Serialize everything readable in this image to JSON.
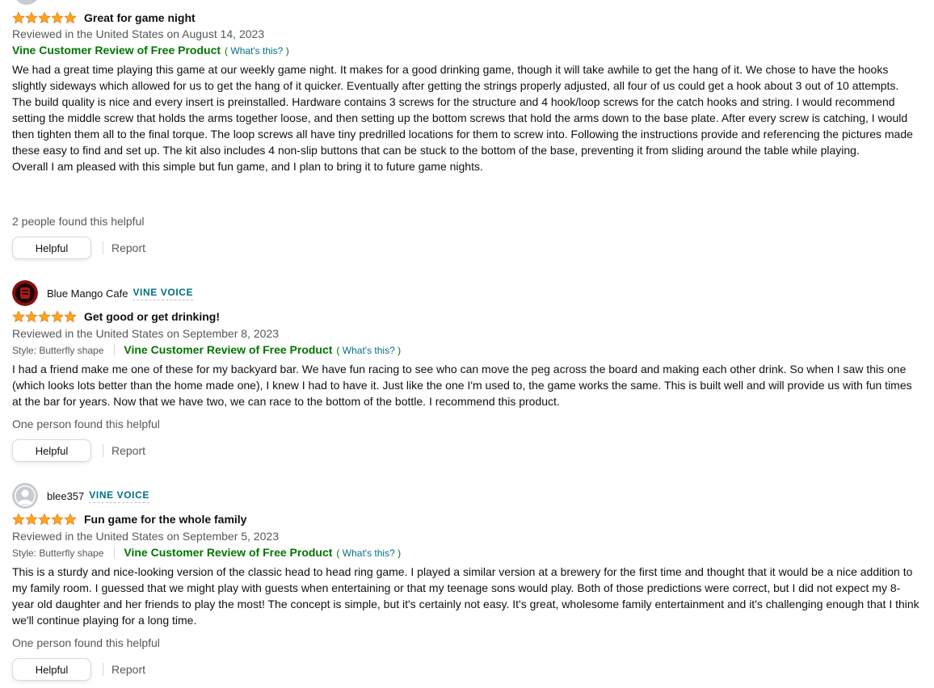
{
  "reviews": [
    {
      "rating": 5,
      "title": "Great for game night",
      "date_line": "Reviewed in the United States on August 14, 2023",
      "vine_label": "Vine Customer Review of Free Product",
      "whats_this": "What's this?",
      "body": [
        "We had a great time playing this game at our weekly game night. It makes for a good drinking game, though it will take awhile to get the hang of it. We chose to have the hooks slightly sideways which allowed for us to get the hang of it quicker. Eventually after getting the strings properly adjusted, all four of us could get a hook about 3 out of 10 attempts.",
        "The build quality is nice and every insert is preinstalled. Hardware contains 3 screws for the structure and 4 hook/loop screws for the catch hooks and string. I would recommend setting the middle screw that holds the arms together loose, and then setting up the bottom screws that hold the arms down to the base plate. After every screw is catching, I would then tighten them all to the final torque. The loop screws all have tiny predrilled locations for them to screw into. Following the instructions provide and referencing the pictures made these easy to find and set up. The kit also includes 4 non-slip buttons that can be stuck to the bottom of the base, preventing it from sliding around the table while playing.",
        "Overall I am pleased with this simple but fun game, and I plan to bring it to future game nights."
      ],
      "helpful_count": "2 people found this helpful",
      "helpful_button": "Helpful",
      "report": "Report"
    },
    {
      "profile_name": "Blue Mango Cafe",
      "badge": "VINE VOICE",
      "avatar": "red-dark-avatar",
      "rating": 5,
      "title": "Get good or get drinking!",
      "date_line": "Reviewed in the United States on September 8, 2023",
      "style": "Style: Butterfly shape",
      "vine_label": "Vine Customer Review of Free Product",
      "whats_this": "What's this?",
      "body": [
        "I had a friend make me one of these for my backyard bar. We have fun racing to see who can move the peg across the board and making each other drink. So when I saw this one (which looks lots better than the home made one), I knew I had to have it. Just like the one I'm used to, the game works the same. This is built well and will provide us with fun times at the bar for years. Now that we have two, we can race to the bottom of the bottle. I recommend this product."
      ],
      "helpful_count": "One person found this helpful",
      "helpful_button": "Helpful",
      "report": "Report"
    },
    {
      "profile_name": "blee357",
      "badge": "VINE VOICE",
      "avatar": "default-user-avatar",
      "rating": 5,
      "title": "Fun game for the whole family",
      "date_line": "Reviewed in the United States on September 5, 2023",
      "style": "Style: Butterfly shape",
      "vine_label": "Vine Customer Review of Free Product",
      "whats_this": "What's this?",
      "body": [
        "This is a sturdy and nice-looking version of the classic head to head ring game. I played a similar version at a brewery for the first time and thought that it would be a nice addition to my family room. I guessed that we might play with guests when entertaining or that my teenage sons would play. Both of those predictions were correct, but I did not expect my 8-year old daughter and her friends to play the most! The concept is simple, but it's certainly not easy. It's great, wholesome family entertainment and it's challenging enough that I think we'll continue playing for a long time."
      ],
      "helpful_count": "One person found this helpful",
      "helpful_button": "Helpful",
      "report": "Report"
    }
  ],
  "colors": {
    "star": "#ffa41c",
    "link": "#007185",
    "vine_green": "#007600",
    "muted": "#565959"
  }
}
